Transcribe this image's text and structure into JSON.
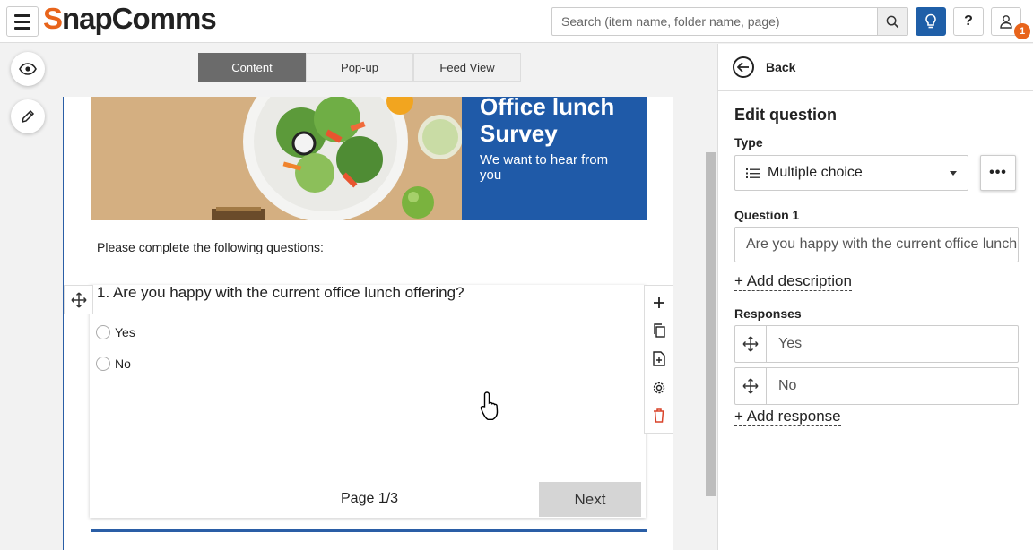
{
  "header": {
    "logo_first": "S",
    "logo_rest": "napComms",
    "search_placeholder": "Search (item name, folder name, page)",
    "help_label": "?",
    "notification_count": "1"
  },
  "tabs": [
    {
      "label": "Content",
      "active": true
    },
    {
      "label": "Pop-up",
      "active": false
    },
    {
      "label": "Feed View",
      "active": false
    }
  ],
  "survey": {
    "banner_title": "Office lunch Survey",
    "banner_subtitle": "We want to hear from you",
    "intro": "Please complete the following questions:",
    "question": "1. Are you happy with the current office lunch offering?",
    "options": [
      "Yes",
      "No"
    ],
    "page_indicator": "Page 1/3",
    "next_label": "Next"
  },
  "panel": {
    "back_label": "Back",
    "title": "Edit question",
    "type_label": "Type",
    "type_value": "Multiple choice",
    "more_label": "•••",
    "question_label": "Question 1",
    "question_value": "Are you happy with the current office lunch offering?",
    "add_description": "+ Add description",
    "responses_label": "Responses",
    "responses": [
      "Yes",
      "No"
    ],
    "add_response": "+ Add response"
  },
  "colors": {
    "brand_orange": "#e8641b",
    "brand_blue": "#1f5aa8",
    "delete_red": "#d9432a"
  },
  "icons": [
    "hamburger-icon",
    "search-icon",
    "lightbulb-icon",
    "user-icon",
    "eye-icon",
    "pencil-icon",
    "move-icon",
    "plus-icon",
    "copy-icon",
    "add-page-icon",
    "gear-icon",
    "trash-icon",
    "hand-cursor-icon",
    "back-arrow-icon",
    "list-icon",
    "chevron-down-icon"
  ]
}
